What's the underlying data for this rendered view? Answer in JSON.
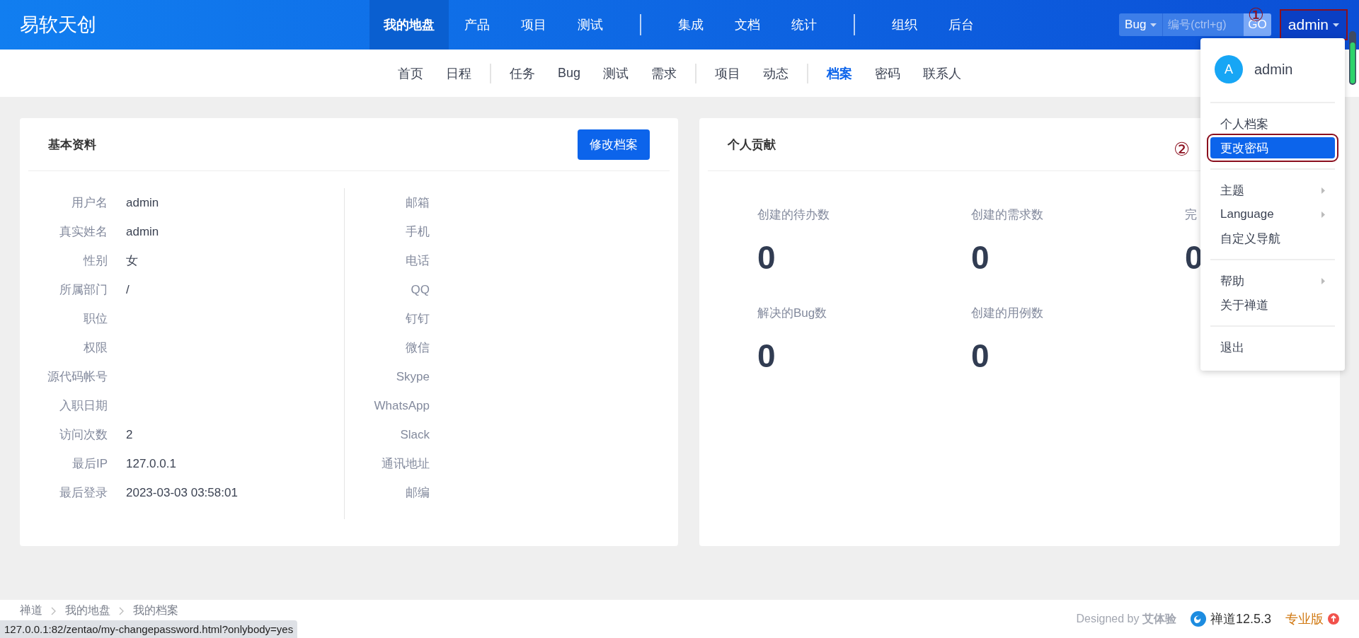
{
  "app": {
    "logo": "易软天创"
  },
  "main_nav_groups": [
    {
      "items": [
        {
          "label": "我的地盘",
          "selected": true
        },
        {
          "label": "产品",
          "selected": false
        },
        {
          "label": "项目",
          "selected": false
        },
        {
          "label": "测试",
          "selected": false
        }
      ]
    },
    {
      "items": [
        {
          "label": "集成",
          "selected": false
        },
        {
          "label": "文档",
          "selected": false
        },
        {
          "label": "统计",
          "selected": false
        }
      ]
    },
    {
      "items": [
        {
          "label": "组织",
          "selected": false
        },
        {
          "label": "后台",
          "selected": false
        }
      ]
    }
  ],
  "search": {
    "type": "Bug",
    "placeholder": "编号(ctrl+g)",
    "button": "GO"
  },
  "user_button": {
    "label": "admin",
    "annotation": "①"
  },
  "sub_nav_groups": [
    {
      "items": [
        {
          "label": "首页",
          "selected": false
        },
        {
          "label": "日程",
          "selected": false
        }
      ]
    },
    {
      "items": [
        {
          "label": "任务",
          "selected": false
        },
        {
          "label": "Bug",
          "selected": false
        },
        {
          "label": "测试",
          "selected": false
        },
        {
          "label": "需求",
          "selected": false
        }
      ]
    },
    {
      "items": [
        {
          "label": "项目",
          "selected": false
        },
        {
          "label": "动态",
          "selected": false
        }
      ]
    },
    {
      "items": [
        {
          "label": "档案",
          "selected": true
        },
        {
          "label": "密码",
          "selected": false
        },
        {
          "label": "联系人",
          "selected": false
        }
      ]
    }
  ],
  "profile": {
    "title": "基本资料",
    "edit_button": "修改档案",
    "left_fields": [
      {
        "label": "用户名",
        "value": "admin"
      },
      {
        "label": "真实姓名",
        "value": "admin"
      },
      {
        "label": "性别",
        "value": "女"
      },
      {
        "label": "所属部门",
        "value": "/"
      },
      {
        "label": "职位"
      },
      {
        "label": "权限"
      },
      {
        "label": "源代码帐号"
      },
      {
        "label": "入职日期"
      },
      {
        "label": "访问次数",
        "value": "2"
      },
      {
        "label": "最后IP",
        "value": "127.0.0.1"
      },
      {
        "label": "最后登录",
        "value": "2023-03-03 03:58:01"
      }
    ],
    "right_fields": [
      {
        "label": "邮箱"
      },
      {
        "label": "手机"
      },
      {
        "label": "电话"
      },
      {
        "label": "QQ"
      },
      {
        "label": "钉钉"
      },
      {
        "label": "微信"
      },
      {
        "label": "Skype"
      },
      {
        "label": "WhatsApp"
      },
      {
        "label": "Slack"
      },
      {
        "label": "通讯地址"
      },
      {
        "label": "邮编"
      }
    ]
  },
  "contribution": {
    "title": "个人贡献",
    "stats": [
      {
        "label": "创建的待办数",
        "value": "0"
      },
      {
        "label": "创建的需求数",
        "value": "0"
      },
      {
        "label": "完",
        "value": "0"
      },
      {
        "label": "解决的Bug数",
        "value": "0"
      },
      {
        "label": "创建的用例数",
        "value": "0"
      }
    ]
  },
  "dropdown": {
    "user": {
      "initial": "A",
      "name": "admin"
    },
    "annotation": "②",
    "sections": [
      [
        {
          "label": "个人档案",
          "submenu": false,
          "selected": false
        },
        {
          "label": "更改密码",
          "submenu": false,
          "selected": true
        }
      ],
      [
        {
          "label": "主题",
          "submenu": true,
          "selected": false
        },
        {
          "label": "Language",
          "submenu": true,
          "selected": false
        },
        {
          "label": "自定义导航",
          "submenu": false,
          "selected": false
        }
      ],
      [
        {
          "label": "帮助",
          "submenu": true,
          "selected": false
        },
        {
          "label": "关于禅道",
          "submenu": false,
          "selected": false
        }
      ],
      [
        {
          "label": "退出",
          "submenu": false,
          "selected": false
        }
      ]
    ]
  },
  "footer": {
    "breadcrumb": [
      "禅道",
      "我的地盘",
      "我的档案"
    ],
    "designed_by": "Designed by **艾体验**",
    "product": "禅道12.5.3",
    "edition": "专业版"
  },
  "status_url": "127.0.0.1:82/zentao/my-changepassword.html?onlybody=yes"
}
